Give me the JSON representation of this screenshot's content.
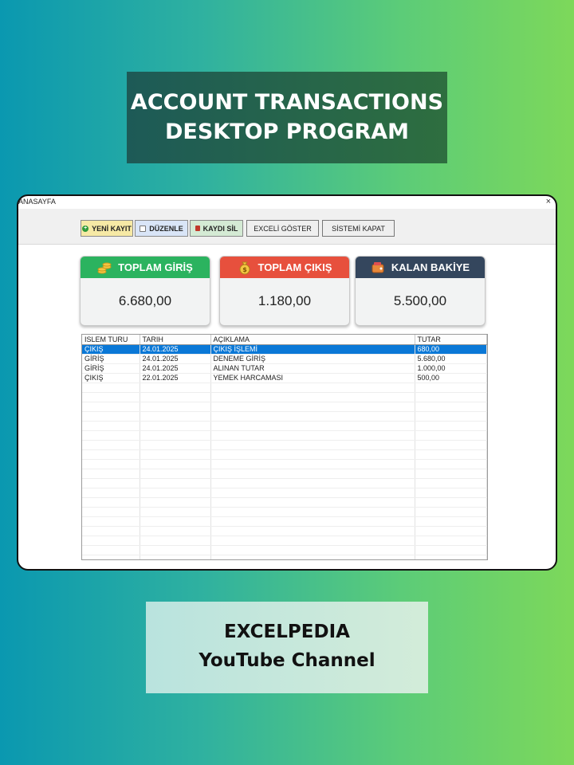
{
  "banner": {
    "line1": "ACCOUNT TRANSACTIONS",
    "line2": "DESKTOP PROGRAM"
  },
  "window": {
    "title": "ANASAYFA",
    "close": "×"
  },
  "toolbar": {
    "new_label": "YENİ KAYIT",
    "edit_label": "DÜZENLE",
    "delete_label": "KAYDI SİL",
    "excel_label": "EXCELİ GÖSTER",
    "close_label": "SİSTEMİ KAPAT"
  },
  "cards": {
    "income": {
      "title": "TOPLAM GİRİŞ",
      "value": "6.680,00",
      "color": "#2bb35f"
    },
    "expense": {
      "title": "TOPLAM ÇIKIŞ",
      "value": "1.180,00",
      "color": "#e7503d"
    },
    "balance": {
      "title": "KALAN BAKİYE",
      "value": "5.500,00",
      "color": "#34465d"
    }
  },
  "table": {
    "columns": [
      "ISLEM TURU",
      "TARIH",
      "AÇIKLAMA",
      "TUTAR"
    ],
    "rows": [
      [
        "ÇIKIŞ",
        "24.01.2025",
        "ÇIKIŞ İŞLEMİ",
        "680,00"
      ],
      [
        "GİRİŞ",
        "24.01.2025",
        "DENEME GİRİŞ",
        "5.680,00"
      ],
      [
        "GİRİŞ",
        "24.01.2025",
        "ALINAN TUTAR",
        "1.000,00"
      ],
      [
        "ÇIKIŞ",
        "22.01.2025",
        "YEMEK HARCAMASI",
        "500,00"
      ]
    ],
    "selected_color": "#0a78d7"
  },
  "footer": {
    "line1": "EXCELPEDIA",
    "line2": "YouTube Channel"
  }
}
